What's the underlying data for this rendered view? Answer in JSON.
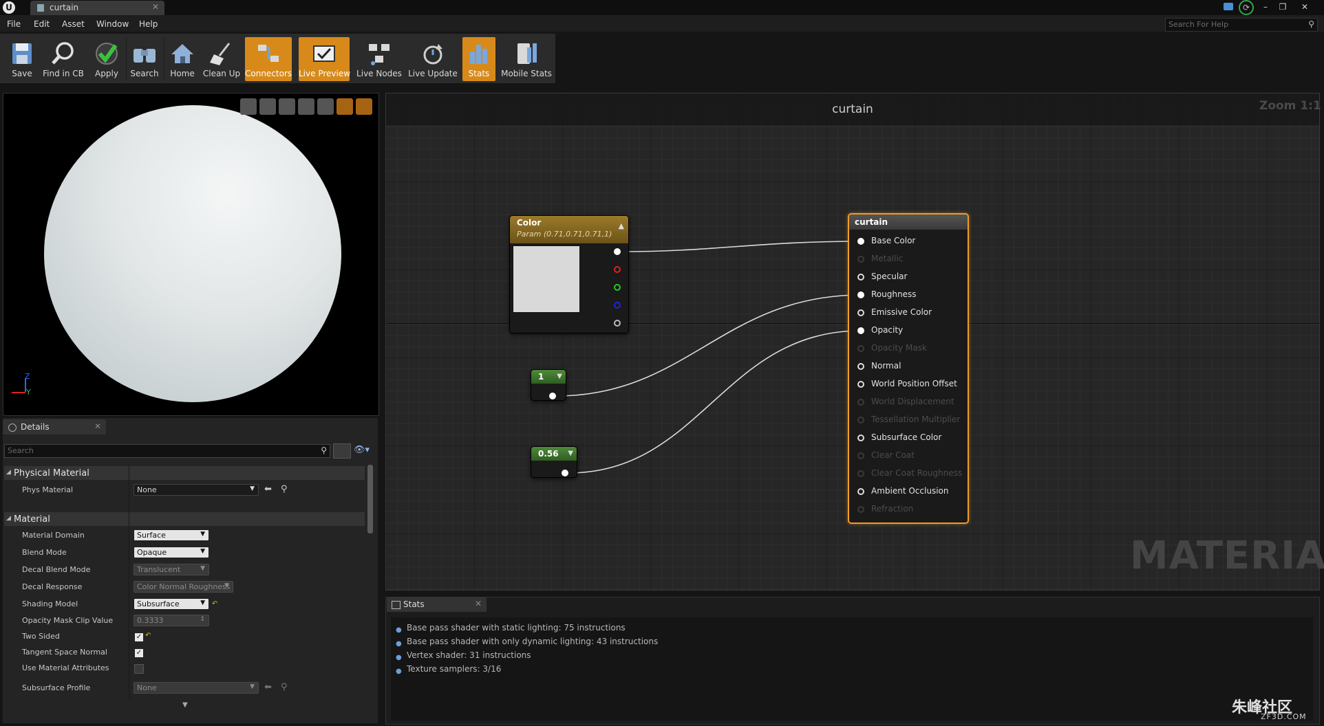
{
  "window": {
    "tab_title": "curtain",
    "close": "✕"
  },
  "menu": [
    "File",
    "Edit",
    "Asset",
    "Window",
    "Help"
  ],
  "help_search_placeholder": "Search For Help",
  "toolbar": [
    {
      "label": "Save",
      "active": false,
      "icon": "save-icon"
    },
    {
      "label": "Find in CB",
      "active": false,
      "icon": "magnifier-icon"
    },
    {
      "label": "Apply",
      "active": false,
      "icon": "checkmark-icon"
    },
    {
      "label": "Search",
      "active": false,
      "icon": "binoculars-icon"
    },
    {
      "label": "Home",
      "active": false,
      "icon": "home-icon"
    },
    {
      "label": "Clean Up",
      "active": false,
      "icon": "broom-icon"
    },
    {
      "label": "Connectors",
      "active": true,
      "icon": "connectors-icon"
    },
    {
      "label": "Live Preview",
      "active": true,
      "icon": "live-preview-icon"
    },
    {
      "label": "Live Nodes",
      "active": false,
      "icon": "live-nodes-icon"
    },
    {
      "label": "Live Update",
      "active": false,
      "icon": "live-update-icon"
    },
    {
      "label": "Stats",
      "active": true,
      "icon": "stats-icon"
    },
    {
      "label": "Mobile Stats",
      "active": false,
      "icon": "mobile-stats-icon"
    }
  ],
  "viewport": {
    "axis_z": "Z",
    "axis_y": "Y"
  },
  "details": {
    "tab": "Details",
    "search_placeholder": "Search",
    "physical_section": "Physical Material",
    "phys_material_label": "Phys Material",
    "phys_material_value": "None",
    "material_section": "Material",
    "props": [
      {
        "label": "Material Domain",
        "value": "Surface",
        "kind": "dropdown"
      },
      {
        "label": "Blend Mode",
        "value": "Opaque",
        "kind": "dropdown"
      },
      {
        "label": "Decal Blend Mode",
        "value": "Translucent",
        "kind": "disabled"
      },
      {
        "label": "Decal Response",
        "value": "Color Normal Roughness",
        "kind": "disabled"
      },
      {
        "label": "Shading Model",
        "value": "Subsurface",
        "kind": "dropdown"
      },
      {
        "label": "Opacity Mask Clip Value",
        "value": "0.3333",
        "kind": "disabled"
      },
      {
        "label": "Two Sided",
        "value": true,
        "kind": "checkbox"
      },
      {
        "label": "Tangent Space Normal",
        "value": true,
        "kind": "checkbox"
      },
      {
        "label": "Use Material Attributes",
        "value": false,
        "kind": "checkbox"
      },
      {
        "label": "Subsurface Profile",
        "value": "None",
        "kind": "disabled"
      }
    ]
  },
  "graph": {
    "title": "curtain",
    "zoom": "Zoom 1:1",
    "watermark": "MATERIAL",
    "color_node": {
      "title": "Color",
      "subtitle": "Param (0.71,0.71,0.71,1)"
    },
    "const1": "1",
    "const2": "0.56",
    "main_node": {
      "title": "curtain",
      "inputs": [
        {
          "label": "Base Color",
          "enabled": true,
          "connected": true
        },
        {
          "label": "Metallic",
          "enabled": false,
          "connected": false
        },
        {
          "label": "Specular",
          "enabled": true,
          "connected": false
        },
        {
          "label": "Roughness",
          "enabled": true,
          "connected": true
        },
        {
          "label": "Emissive Color",
          "enabled": true,
          "connected": false
        },
        {
          "label": "Opacity",
          "enabled": true,
          "connected": true
        },
        {
          "label": "Opacity Mask",
          "enabled": false,
          "connected": false
        },
        {
          "label": "Normal",
          "enabled": true,
          "connected": false
        },
        {
          "label": "World Position Offset",
          "enabled": true,
          "connected": false
        },
        {
          "label": "World Displacement",
          "enabled": false,
          "connected": false
        },
        {
          "label": "Tessellation Multiplier",
          "enabled": false,
          "connected": false
        },
        {
          "label": "Subsurface Color",
          "enabled": true,
          "connected": false
        },
        {
          "label": "Clear Coat",
          "enabled": false,
          "connected": false
        },
        {
          "label": "Clear Coat Roughness",
          "enabled": false,
          "connected": false
        },
        {
          "label": "Ambient Occlusion",
          "enabled": true,
          "connected": false
        },
        {
          "label": "Refraction",
          "enabled": false,
          "connected": false
        }
      ]
    }
  },
  "stats": {
    "tab": "Stats",
    "lines": [
      "Base pass shader with static lighting: 75 instructions",
      "Base pass shader with only dynamic lighting: 43 instructions",
      "Vertex shader: 31 instructions",
      "Texture samplers: 3/16"
    ]
  },
  "site": {
    "logo": "朱峰社区",
    "url": "ZF3D.COM"
  }
}
